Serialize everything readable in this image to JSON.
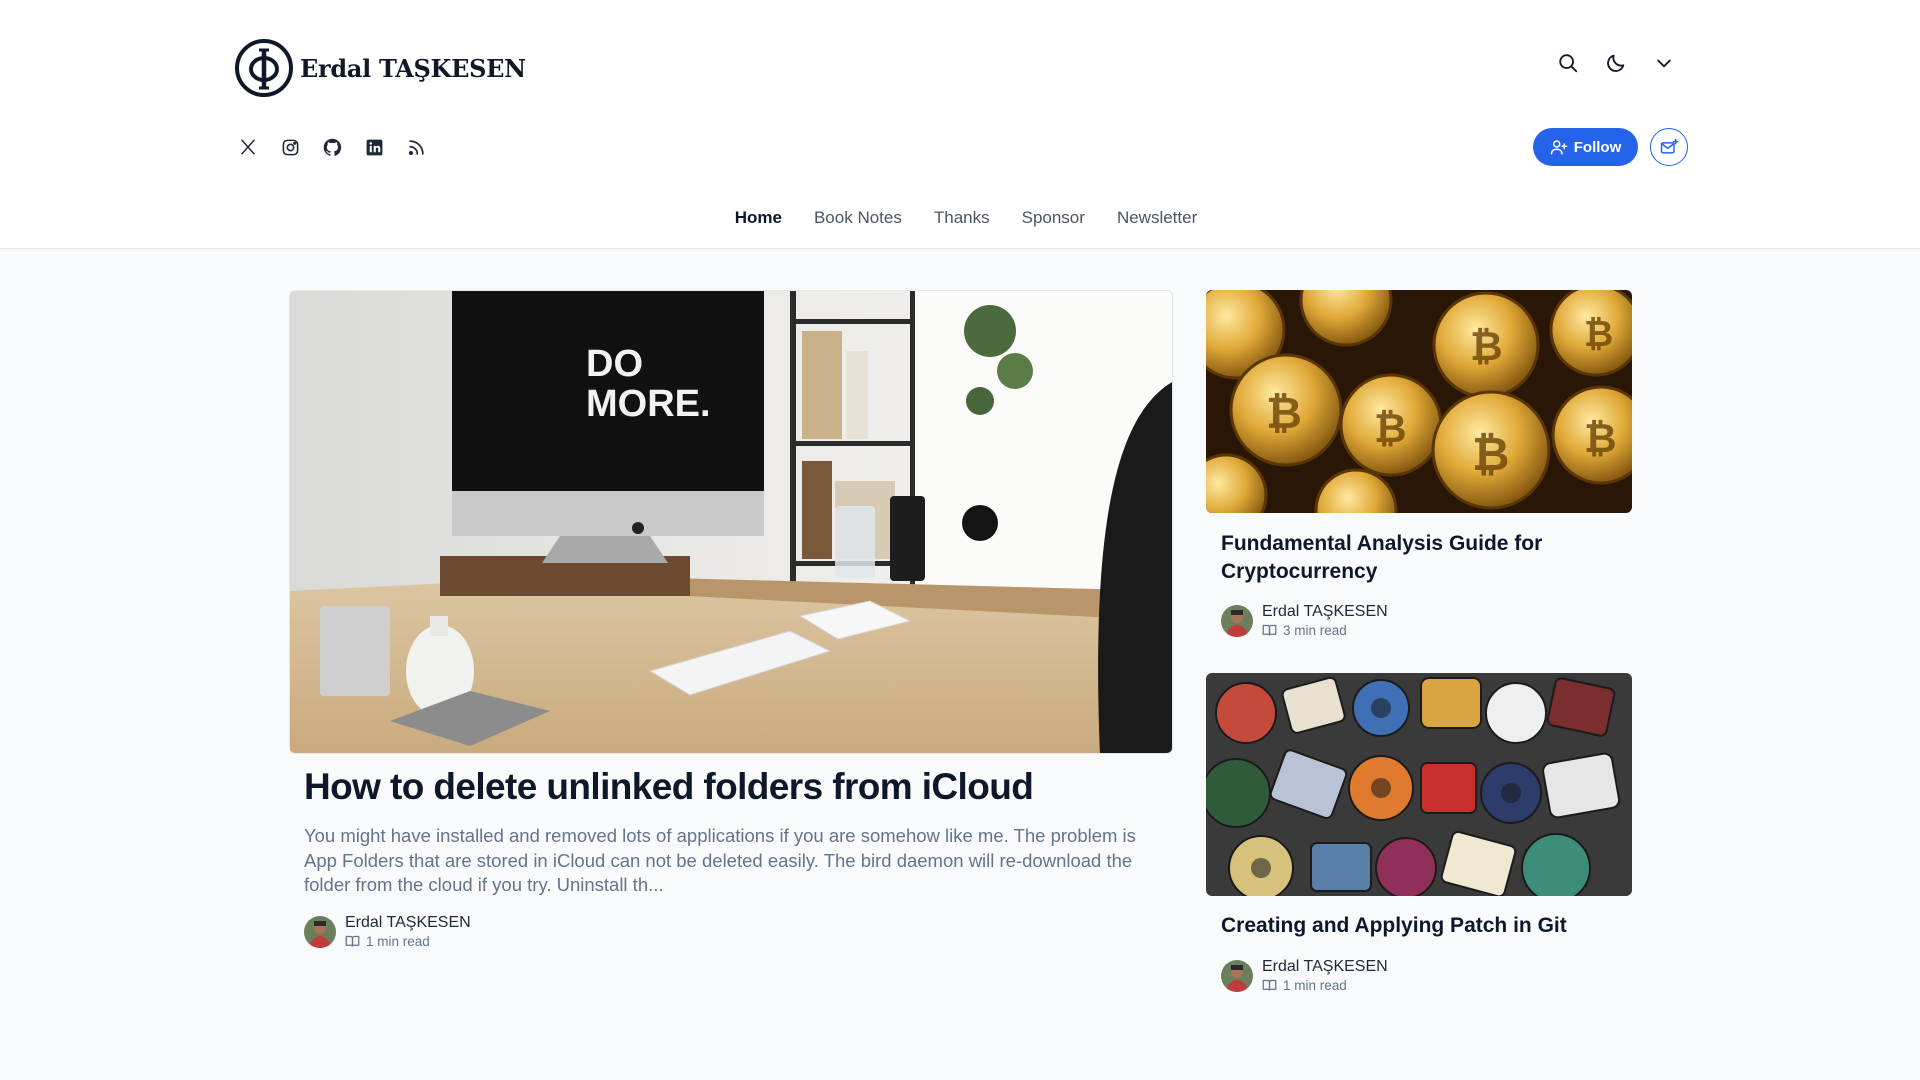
{
  "site": {
    "name": "Erdal TAŞKESEN"
  },
  "header": {
    "follow_label": "Follow",
    "actions": [
      "search-icon",
      "moon-icon",
      "chevron-down-icon"
    ],
    "socials": [
      "x-icon",
      "instagram-icon",
      "github-icon",
      "linkedin-icon",
      "rss-icon"
    ]
  },
  "nav": {
    "items": [
      {
        "label": "Home",
        "active": true
      },
      {
        "label": "Book Notes",
        "active": false
      },
      {
        "label": "Thanks",
        "active": false
      },
      {
        "label": "Sponsor",
        "active": false
      },
      {
        "label": "Newsletter",
        "active": false
      }
    ]
  },
  "featured": {
    "image_text": "DO MORE.",
    "title": "How to delete unlinked folders from iCloud",
    "excerpt": "You might have installed and removed lots of applications if you are somehow like me. The problem is App Folders that are stored in iCloud can not be deleted easily. The bird daemon will re-download the folder from the cloud if you try. Uninstall th...",
    "author": "Erdal TAŞKESEN",
    "read_time": "1 min read"
  },
  "cards": [
    {
      "title": "Fundamental Analysis Guide for Cryptocurrency",
      "author": "Erdal TAŞKESEN",
      "read_time": "3 min read"
    },
    {
      "title": "Creating and Applying Patch in Git",
      "author": "Erdal TAŞKESEN",
      "read_time": "1 min read"
    }
  ],
  "colors": {
    "accent": "#2563eb",
    "background": "#f8fafc",
    "text": "#0f172a",
    "muted": "#64748b"
  }
}
